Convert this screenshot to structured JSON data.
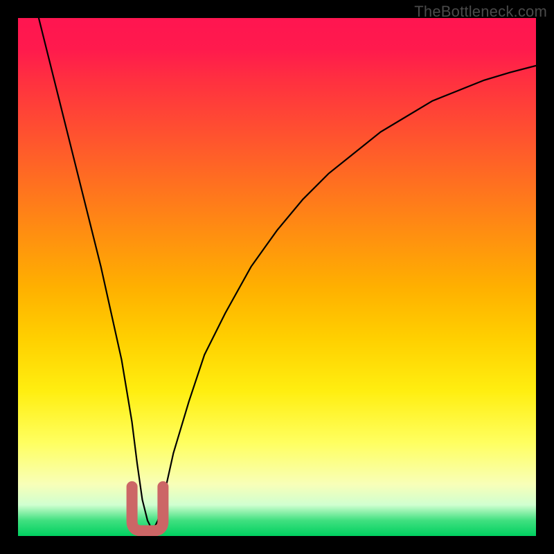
{
  "watermark": "TheBottleneck.com",
  "colors": {
    "page_background": "#000000",
    "curve_stroke": "#000000",
    "marker_stroke": "#cc6666",
    "gradient_stops": [
      {
        "offset": 0,
        "color": "#ff1550"
      },
      {
        "offset": 6,
        "color": "#ff1a4d"
      },
      {
        "offset": 12,
        "color": "#ff3040"
      },
      {
        "offset": 22,
        "color": "#ff5030"
      },
      {
        "offset": 32,
        "color": "#ff7020"
      },
      {
        "offset": 42,
        "color": "#ff9010"
      },
      {
        "offset": 52,
        "color": "#ffb000"
      },
      {
        "offset": 62,
        "color": "#ffd000"
      },
      {
        "offset": 72,
        "color": "#ffee10"
      },
      {
        "offset": 82,
        "color": "#ffff60"
      },
      {
        "offset": 90,
        "color": "#f8ffb8"
      },
      {
        "offset": 94,
        "color": "#d0ffd0"
      },
      {
        "offset": 97,
        "color": "#40e080"
      },
      {
        "offset": 100,
        "color": "#00d060"
      }
    ]
  },
  "chart_data": {
    "type": "line",
    "title": "",
    "xlabel": "",
    "ylabel": "",
    "xlim": [
      0,
      100
    ],
    "ylim": [
      0,
      100
    ],
    "series": [
      {
        "name": "bottleneck-curve",
        "x": [
          4,
          6,
          8,
          10,
          12,
          14,
          16,
          18,
          20,
          22,
          23,
          24,
          25,
          26,
          27,
          28,
          30,
          33,
          36,
          40,
          45,
          50,
          55,
          60,
          65,
          70,
          75,
          80,
          85,
          90,
          95,
          100
        ],
        "values": [
          100,
          92,
          84,
          76,
          68,
          60,
          52,
          43,
          34,
          22,
          14,
          7,
          3,
          1,
          3,
          7,
          16,
          26,
          35,
          43,
          52,
          59,
          65,
          70,
          74,
          78,
          81,
          84,
          86,
          88,
          89.5,
          90.8
        ]
      }
    ],
    "marker": {
      "name": "optimal-range",
      "x_start": 22,
      "x_end": 28,
      "shape": "u"
    }
  }
}
